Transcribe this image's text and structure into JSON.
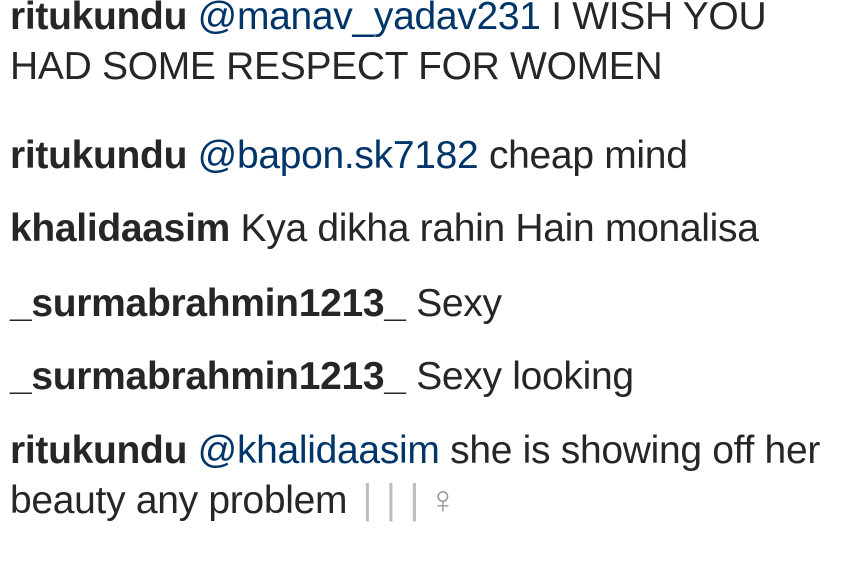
{
  "comments": [
    {
      "username": "ritukundu",
      "mention": "@manav_yadav231",
      "text": "I WISH YOU HAD SOME RESPECT FOR WOMEN"
    },
    {
      "username": "ritukundu",
      "mention": "@bapon.sk7182",
      "text": "cheap mind"
    },
    {
      "username": "khalidaasim",
      "text": "Kya dikha rahin Hain monalisa"
    },
    {
      "username": "_surmabrahmin1213_",
      "text": "Sexy"
    },
    {
      "username": "_surmabrahmin1213_",
      "text": "Sexy looking"
    },
    {
      "username": "ritukundu",
      "mention": "@khalidaasim",
      "text": "she is showing off her beauty any problem",
      "emoji_bars": "∣∣∣",
      "emoji_symbol": "♀"
    }
  ],
  "colors": {
    "username": "#262626",
    "mention": "#003569",
    "text": "#262626"
  }
}
